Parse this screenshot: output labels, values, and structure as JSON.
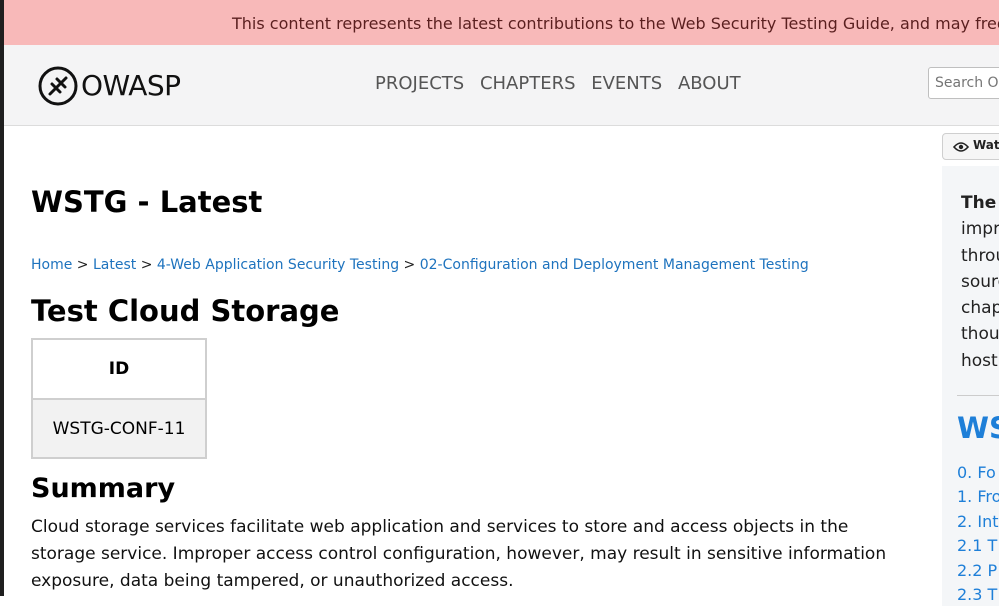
{
  "banner": {
    "text": "This content represents the latest contributions to the Web Security Testing Guide, and may frequently change."
  },
  "header": {
    "logo_text": "OWASP",
    "nav": [
      "PROJECTS",
      "CHAPTERS",
      "EVENTS",
      "ABOUT"
    ],
    "search_placeholder": "Search OWASP.org"
  },
  "github": {
    "watch_label": "Watch"
  },
  "main": {
    "site_title": "WSTG - Latest",
    "breadcrumb": [
      "Home",
      "Latest",
      "4-Web Application Security Testing",
      "02-Configuration and Deployment Management Testing"
    ],
    "breadcrumb_sep": ">",
    "page_title": "Test Cloud Storage",
    "table": {
      "header": "ID",
      "value": "WSTG-CONF-11"
    },
    "summary_heading": "Summary",
    "summary_text": "Cloud storage services facilitate web application and services to store and access objects in the storage service. Improper access control configuration, however, may result in sensitive information exposure, data being tampered, or unauthorized access."
  },
  "sidebar": {
    "lead_bold": "The",
    "lines": [
      "impr",
      "throu",
      "sourc",
      "chap",
      "thou",
      "host"
    ],
    "heading": "WS",
    "toc": [
      "0. Fo",
      "1. Fro",
      "2. Int",
      "2.1 T",
      "2.2 P",
      "2.3 T"
    ]
  },
  "colors": {
    "banner_bg": "#f8b9b9",
    "link": "#1e73be",
    "accent": "#1e7fd8",
    "header_bg": "#f4f4f5"
  }
}
